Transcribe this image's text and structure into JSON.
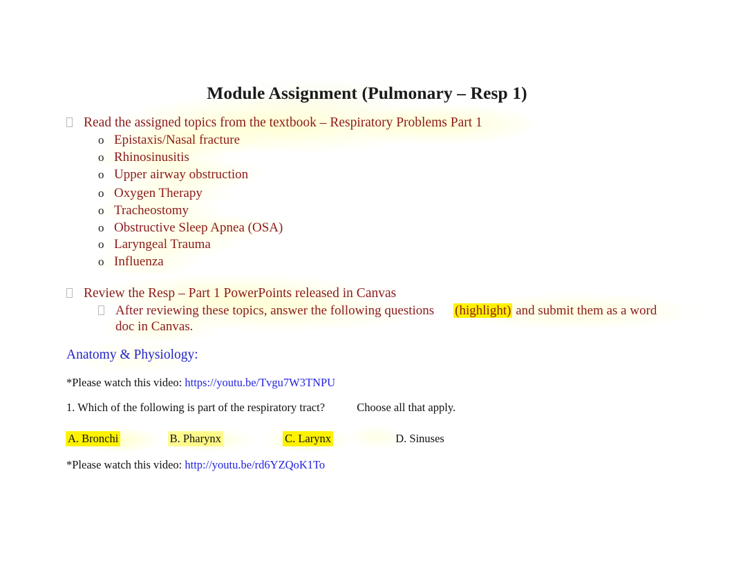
{
  "document": {
    "title": "Module Assignment (Pulmonary – Resp 1)"
  },
  "bullets": [
    {
      "marker": "tofu",
      "text": "Read the assigned topics from the textbook – Respiratory Problems Part 1",
      "sub_marker": "o",
      "sub_items": [
        "Epistaxis/Nasal fracture",
        "Rhinosinusitis",
        "Upper airway obstruction",
        "Oxygen Therapy",
        "Tracheostomy",
        "Obstructive Sleep Apnea (OSA)",
        "Laryngeal Trauma",
        "Influenza"
      ]
    },
    {
      "marker": "tofu",
      "text": "Review the Resp – Part 1 PowerPoints released in Canvas",
      "sub_marker": "tofu",
      "sub_paragraph": {
        "before": "After reviewing these topics, answer the following questions",
        "highlighted": "(highlight)",
        "after": "and submit them as a word doc in Canvas."
      }
    }
  ],
  "section": {
    "heading": "Anatomy & Physiology:"
  },
  "videos": [
    {
      "label": "*Please watch this video:",
      "url": "https://youtu.be/Tvgu7W3TNPU"
    },
    {
      "label": "*Please watch this video:",
      "url": "http://youtu.be/rd6YZQoK1To"
    }
  ],
  "question": {
    "number": "1.",
    "prompt": "Which of the following is part of the respiratory tract?",
    "instruction": "Choose all that apply.",
    "options": [
      {
        "label": "A. Bronchi",
        "highlight": "strong"
      },
      {
        "label": "B. Pharynx",
        "highlight": "soft"
      },
      {
        "label": "C. Larynx",
        "highlight": "strong"
      },
      {
        "label": "D.  Sinuses",
        "highlight": "none"
      }
    ]
  },
  "colors": {
    "body_red": "#8C1A1A",
    "heading_blue": "#2222CC",
    "link_blue": "#2222DD",
    "highlight_yellow": "#FFF200",
    "title_black": "#1A1A1A"
  }
}
